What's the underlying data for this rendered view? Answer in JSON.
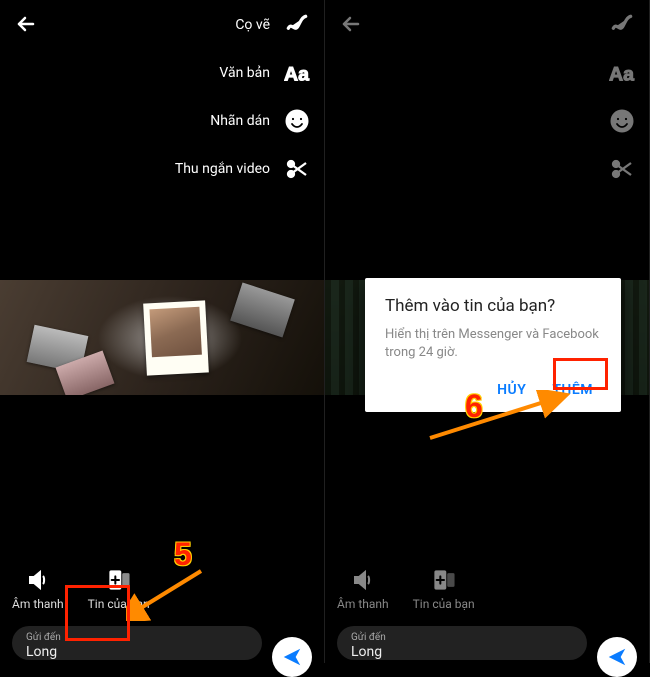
{
  "tools": {
    "brush": "Cọ vẽ",
    "text": "Văn bản",
    "sticker": "Nhãn dán",
    "trim": "Thu ngắn video"
  },
  "bottom": {
    "sound": "Âm thanh",
    "story": "Tin của bạn",
    "send_hint": "Gửi đến",
    "send_value": "Long"
  },
  "dialog": {
    "title": "Thêm vào tin của bạn?",
    "body": "Hiển thị trên Messenger và Facebook trong 24 giờ.",
    "cancel": "HỦY",
    "confirm": "THÊM"
  },
  "annotations": {
    "step5": "5",
    "step6": "6"
  },
  "colors": {
    "accent": "#0a7cff",
    "annotation": "#ff2200"
  }
}
